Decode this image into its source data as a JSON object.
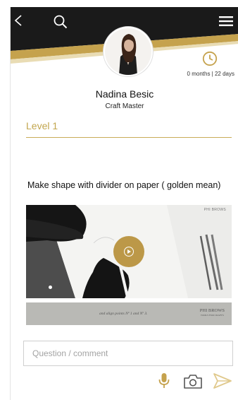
{
  "header": {
    "back_icon": "chevron-left-icon",
    "search_icon": "search-icon",
    "menu_icon": "hamburger-menu-icon",
    "colors": {
      "bar": "#1a1a1a",
      "accent": "#c5a24d"
    }
  },
  "profile": {
    "name": "Nadina Besic",
    "role": "Craft Master",
    "timer_icon": "clock-icon",
    "duration": "0 months | 22 days"
  },
  "level": {
    "label": "Level 1",
    "color": "#c2a64e"
  },
  "task": {
    "description": "Make shape with divider on paper ( golden mean)",
    "video": {
      "play_icon": "play-icon",
      "logo_text": "PHI BROWS",
      "caption": "and align points Nº 1 and Nº 3.",
      "caption_logo": "PHI BROWS",
      "caption_logo_sub": "TOOLS FOR CRAFTS"
    }
  },
  "comment": {
    "placeholder": "Question / comment",
    "value": ""
  },
  "actions": {
    "mic_icon": "microphone-icon",
    "camera_icon": "camera-icon",
    "send_icon": "send-icon",
    "icon_color": "#c5a24d"
  }
}
